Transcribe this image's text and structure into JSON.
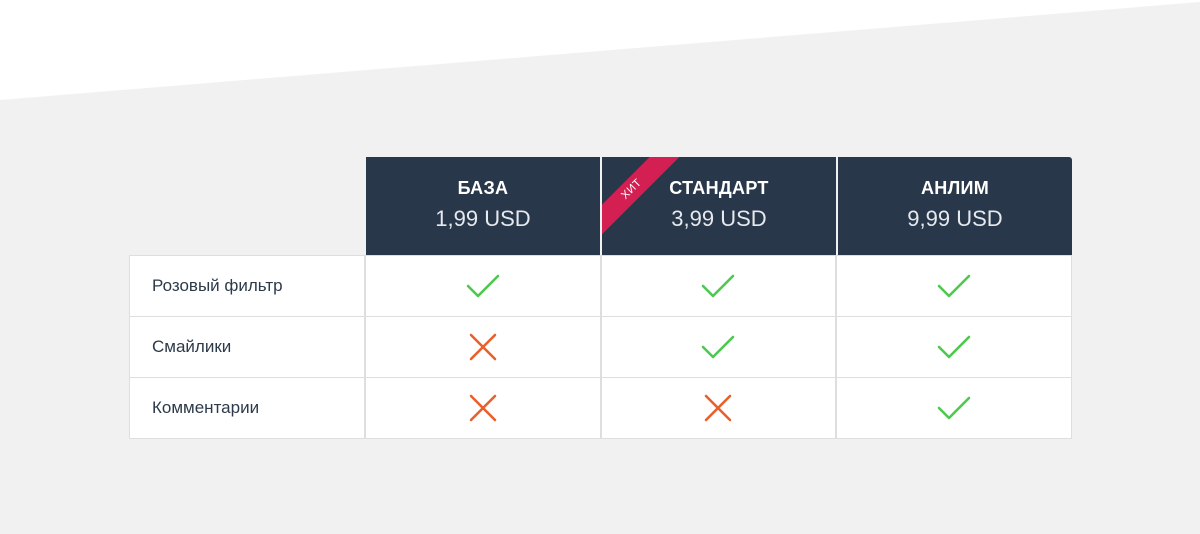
{
  "colors": {
    "background": "#f1f1f1",
    "header": "#29374a",
    "ribbon": "#d41f53",
    "check": "#4cc94f",
    "cross": "#e8602c",
    "text": "#2c3a4a"
  },
  "plans": [
    {
      "name": "БАЗА",
      "price": "1,99 USD",
      "badge": ""
    },
    {
      "name": "СТАНДАРТ",
      "price": "3,99 USD",
      "badge": "ХИТ"
    },
    {
      "name": "АНЛИМ",
      "price": "9,99 USD",
      "badge": ""
    }
  ],
  "features": [
    {
      "label": "Розовый фильтр",
      "availability": [
        true,
        true,
        true
      ]
    },
    {
      "label": "Смайлики",
      "availability": [
        false,
        true,
        true
      ]
    },
    {
      "label": "Комментарии",
      "availability": [
        false,
        false,
        true
      ]
    }
  ]
}
